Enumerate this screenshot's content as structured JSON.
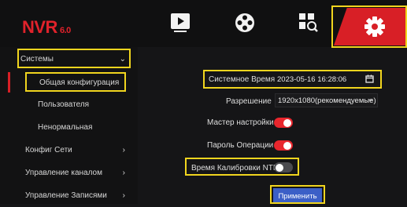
{
  "brand": {
    "name": "NVR",
    "version": "6.0"
  },
  "topnav": {
    "items": [
      {
        "name": "playback",
        "icon": "play-icon"
      },
      {
        "name": "channels",
        "icon": "reel-icon"
      },
      {
        "name": "search",
        "icon": "search-list-icon"
      },
      {
        "name": "settings",
        "icon": "gear-icon",
        "active": true
      }
    ],
    "accent": "#d81f26"
  },
  "sidebar": {
    "section_title": "Системы",
    "items": [
      {
        "label": "Общая конфигурация",
        "active": true
      },
      {
        "label": "Пользователя"
      },
      {
        "label": "Ненормальная"
      }
    ],
    "groups": [
      {
        "label": "Конфиг Сети"
      },
      {
        "label": "Управление каналом"
      },
      {
        "label": "Управление Записями"
      }
    ]
  },
  "form": {
    "system_time_label": "Системное Время",
    "system_time_value": "2023-05-16 16:28:06",
    "resolution_label": "Разрешение",
    "resolution_value": "1920x1080(рекомендуемые)",
    "wizard_label": "Мастер настройки",
    "wizard_on": true,
    "password_label": "Пароль Операции",
    "password_on": true,
    "ntp_label": "Время Калибровки NTP",
    "ntp_on": false,
    "apply_label": "Применить"
  },
  "colors": {
    "highlight": "#f1d51e",
    "toggle_on": "#e8262d",
    "button": "#3b5fc7"
  }
}
